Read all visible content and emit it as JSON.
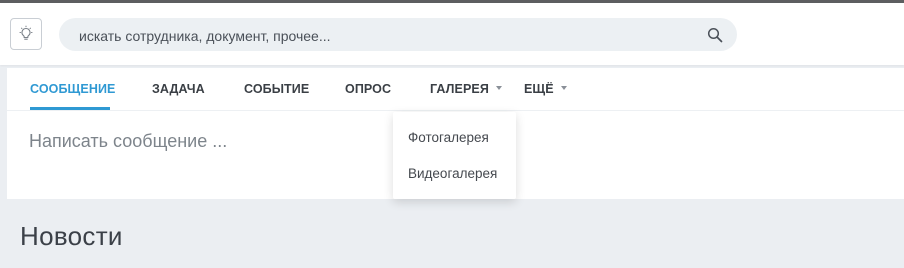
{
  "header": {
    "search": {
      "placeholder": "искать сотрудника, документ, прочее..."
    }
  },
  "icons": {
    "bulb": "lightbulb-icon",
    "search": "search-icon",
    "caret": "chevron-down-icon"
  },
  "colors": {
    "accent": "#2f99d3",
    "page_background": "#ebeef2"
  },
  "composer": {
    "tabs": [
      {
        "label": "СООБЩЕНИЕ",
        "active": true
      },
      {
        "label": "ЗАДАЧА"
      },
      {
        "label": "СОБЫТИЕ"
      },
      {
        "label": "ОПРОС"
      },
      {
        "label": "ГАЛЕРЕЯ",
        "has_dropdown": true
      },
      {
        "label": "ЕЩЁ",
        "has_dropdown": true
      }
    ],
    "placeholder": "Написать сообщение ..."
  },
  "gallery_menu": {
    "items": [
      "Фотогалерея",
      "Видеогалерея"
    ]
  },
  "news": {
    "title": "Новости"
  }
}
